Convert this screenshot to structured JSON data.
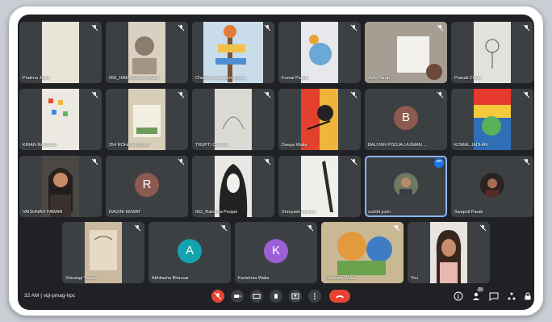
{
  "meeting": {
    "time_code": "32 AM | vql-pmag-hpc",
    "participant_count": "29"
  },
  "colors": {
    "background": "#202124",
    "tile": "#3c4043",
    "speaking_border": "#8ab4f8",
    "end_call": "#ea4335",
    "avatar_b": "#8d5a4f",
    "avatar_r": "#8d5a4f",
    "avatar_a": "#12a4af",
    "avatar_k": "#9c5fd6"
  },
  "tiles": [
    {
      "name": "Pratima Joshi",
      "media": "drawing"
    },
    {
      "name": "058_HIMANSHU PAWAR",
      "media": "drawing"
    },
    {
      "name": "Chaittar Mahakarni Muru...",
      "media": "drawing"
    },
    {
      "name": "Komal Pandit",
      "media": "drawing"
    },
    {
      "name": "Aditi Parab",
      "media": "drawing"
    },
    {
      "name": "Pranali Chuto",
      "media": "drawing"
    },
    {
      "name": "KIRAN RAMESH",
      "media": "drawing"
    },
    {
      "name": "254 ROHAN YADAV",
      "media": "drawing"
    },
    {
      "name": "TRUPTI CHVAN",
      "media": "drawing"
    },
    {
      "name": "Deepa Walia",
      "media": "drawing"
    },
    {
      "name": "BALIYAN POOJA LAXMAN ...",
      "avatar": "B"
    },
    {
      "name": "KOMAL JADHAV",
      "media": "drawing"
    },
    {
      "name": "VAISHNAVI PAWAR",
      "media": "camera"
    },
    {
      "name": "RAGINI KEWAT",
      "avatar": "R"
    },
    {
      "name": "062_Rakshita Poojari",
      "media": "drawing"
    },
    {
      "name": "Shreyash Mahkar",
      "media": "drawing"
    },
    {
      "name": "surbhi joshi",
      "media": "photo-avatar"
    },
    {
      "name": "Swapnil Parab",
      "media": "photo-avatar"
    },
    {
      "name": "Shivangi Yadav",
      "media": "drawing"
    },
    {
      "name": "Abhilasha Bhavsar",
      "avatar": "A"
    },
    {
      "name": "Karishma Walia",
      "avatar": "K"
    },
    {
      "name": "Karishma Walia",
      "media": "drawing"
    },
    {
      "name": "You",
      "media": "camera"
    }
  ],
  "controls": {
    "icons": [
      "mic-off-icon",
      "camera-icon",
      "captions-icon",
      "raise-hand-icon",
      "present-icon",
      "more-options-icon",
      "end-call-icon"
    ],
    "right_icons": [
      "info-icon",
      "people-icon",
      "chat-icon",
      "activities-icon",
      "lock-icon"
    ]
  }
}
